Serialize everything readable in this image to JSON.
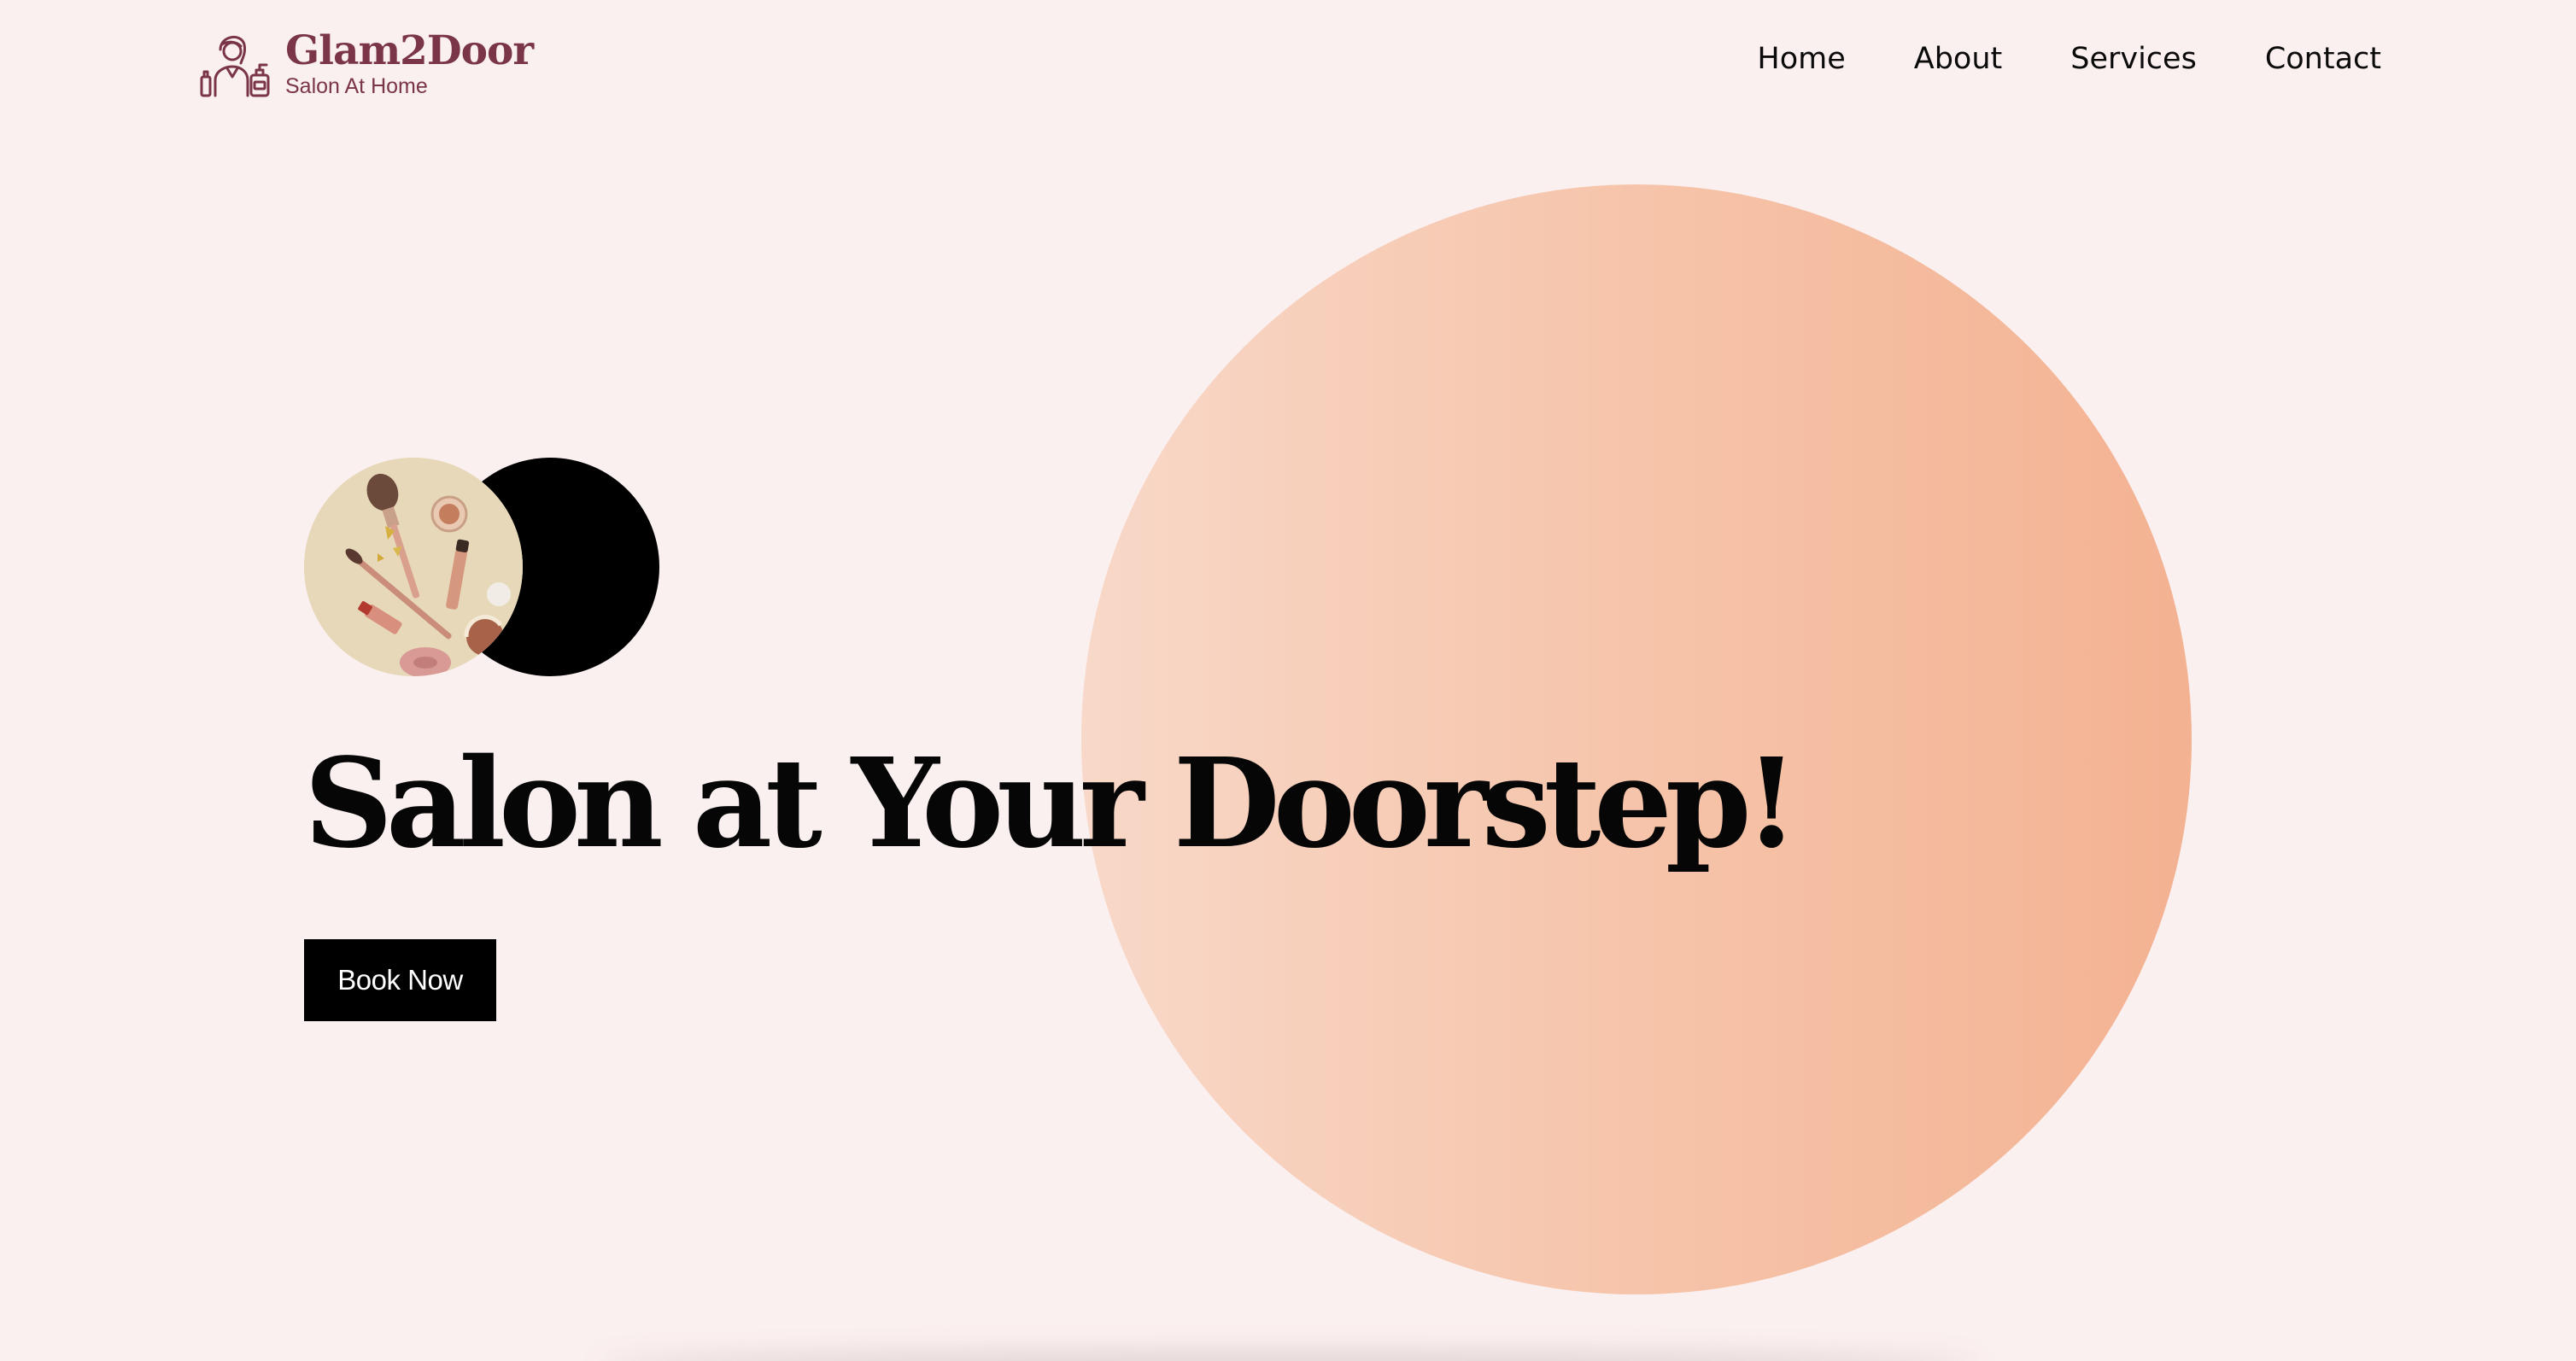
{
  "brand": {
    "name": "Glam2Door",
    "tagline": "Salon At Home",
    "icon": "stylist-logo-icon"
  },
  "nav": {
    "items": [
      "Home",
      "About",
      "Services",
      "Contact"
    ]
  },
  "hero": {
    "headline": "Salon at Your Doorstep!",
    "cta_label": "Book Now",
    "image": "makeup-brushes-photo"
  },
  "colors": {
    "background": "#fbf0f0",
    "brand": "#7a3548",
    "circle_gradient_start": "#f8d8c8",
    "circle_gradient_end": "#f3b292",
    "button": "#000000"
  }
}
